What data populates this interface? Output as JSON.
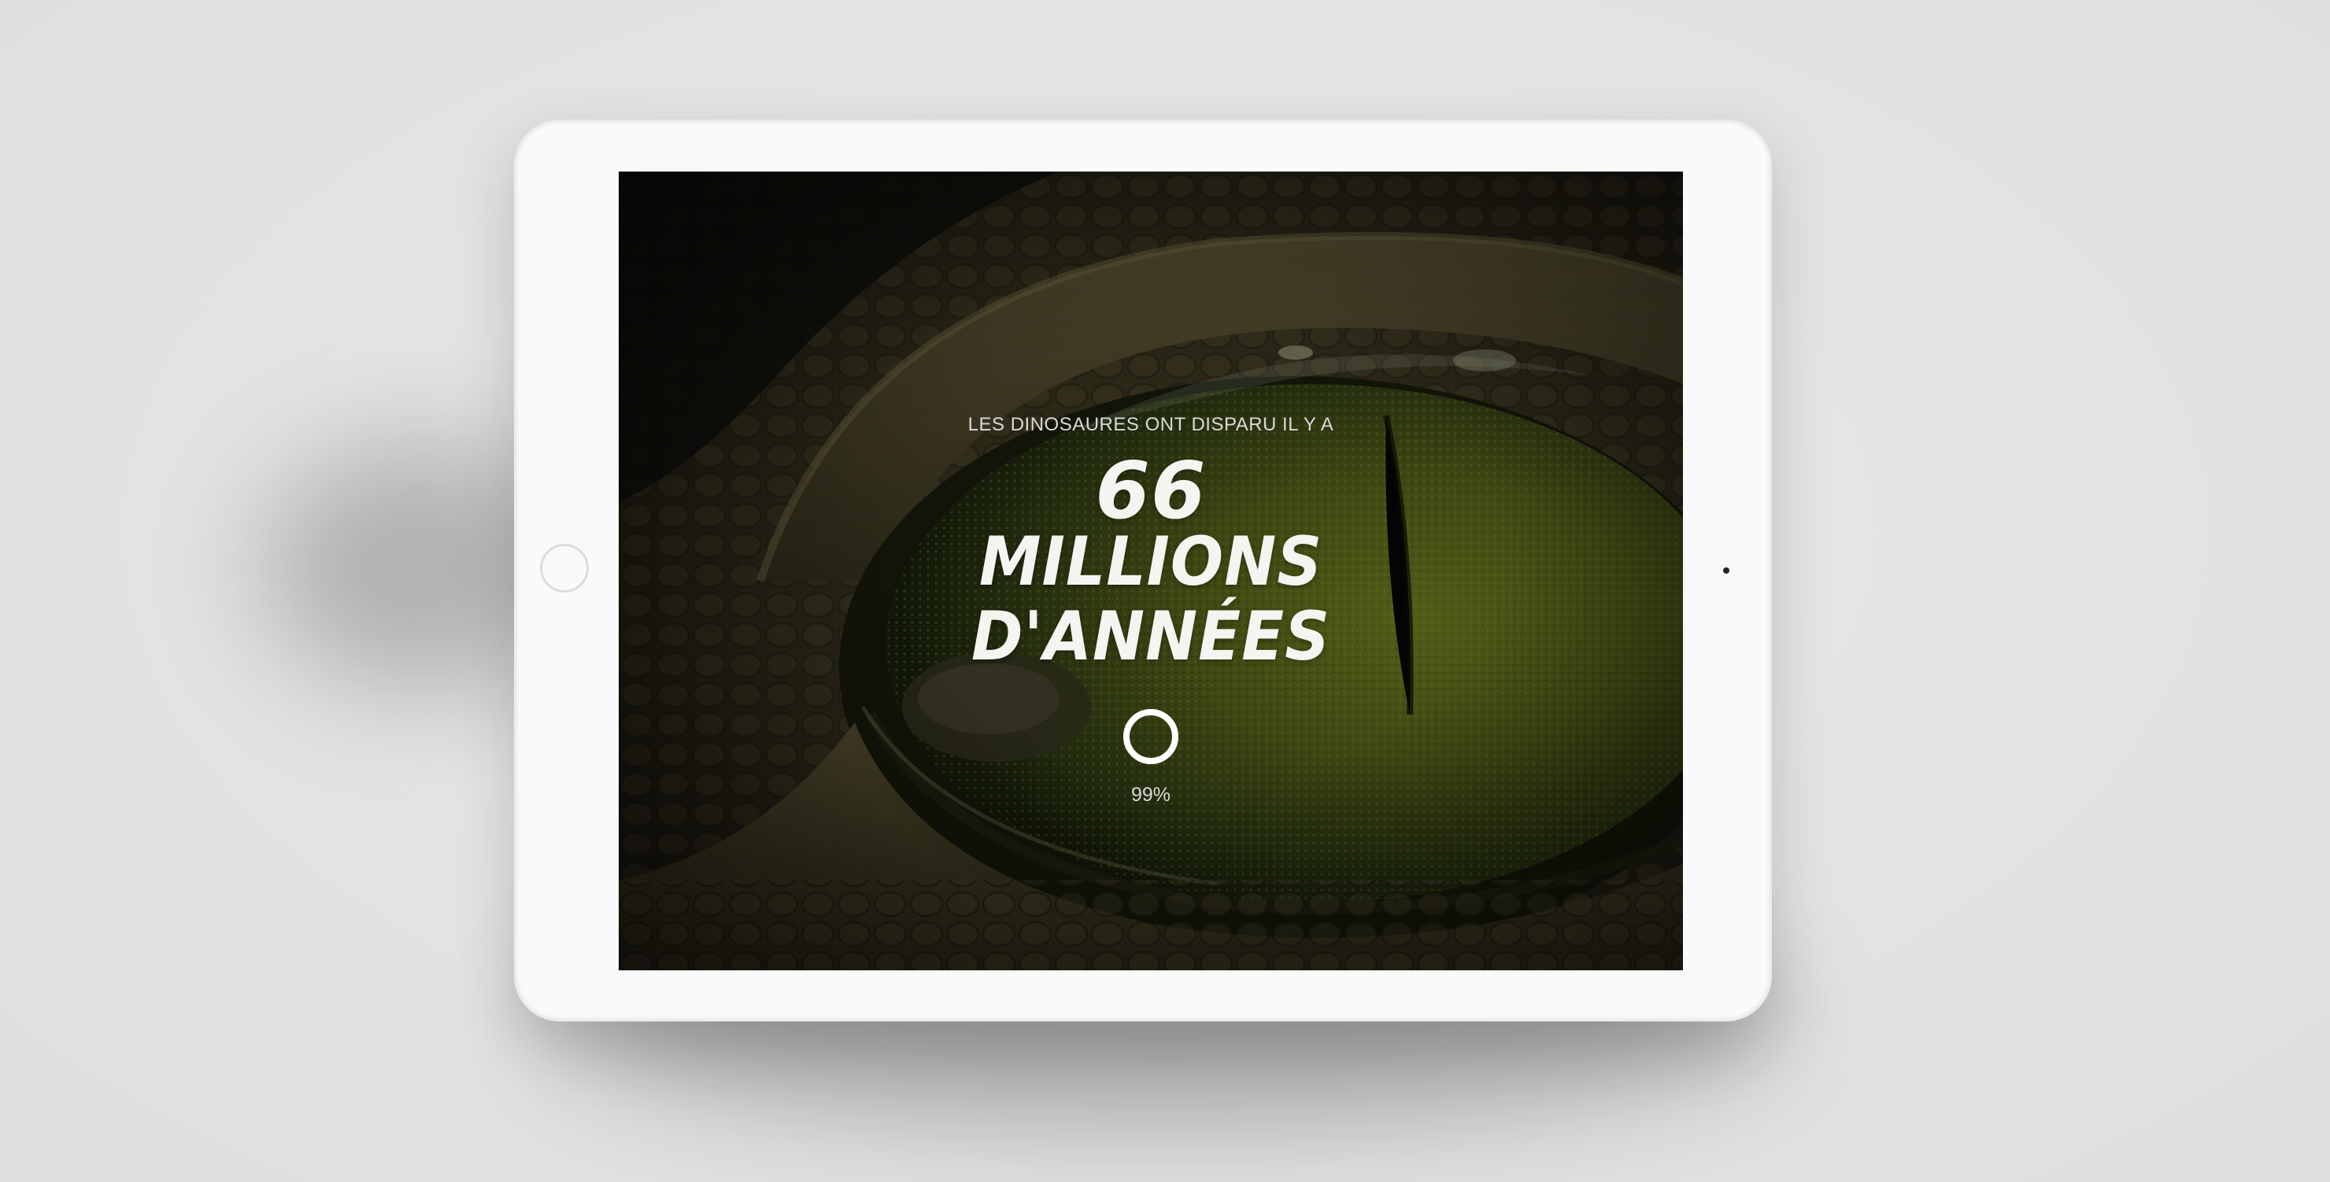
{
  "screen": {
    "intro_text": "LES DINOSAURES ONT DISPARU IL Y A",
    "headline": {
      "line1": "66",
      "line2": "MILLIONS",
      "line3": "D'ANNÉES"
    },
    "loading": {
      "progress": 0.99,
      "label": "99%"
    },
    "background_image": "reptile-eye-closeup"
  },
  "colors": {
    "page_background": "#e4e4e4",
    "tablet_frame": "#fafafa",
    "text_primary": "#f4f4f0",
    "text_secondary": "#d9d9d9",
    "iris": "#5c6a1c"
  },
  "icons": {
    "loader": "progress-ring-icon",
    "home": "home-button-icon"
  }
}
